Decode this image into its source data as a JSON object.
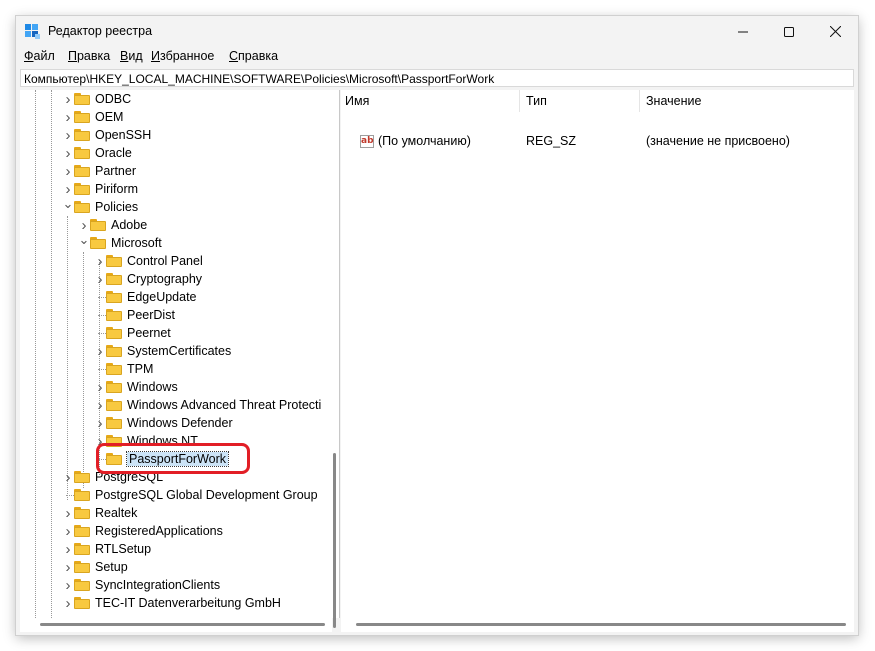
{
  "window": {
    "title": "Редактор реестра",
    "minimize_glyph": "—",
    "maximize_glyph": "☐",
    "close_glyph": "✕"
  },
  "menu": [
    {
      "underline": "Ф",
      "rest": "айл"
    },
    {
      "underline": "П",
      "rest": "равка"
    },
    {
      "underline": "В",
      "rest": "ид"
    },
    {
      "underline": "И",
      "rest": "збранное"
    },
    {
      "underline": "С",
      "rest": "правка"
    }
  ],
  "address_path": "Компьютер\\HKEY_LOCAL_MACHINE\\SOFTWARE\\Policies\\Microsoft\\PassportForWork",
  "tree": {
    "items": [
      {
        "label": "ODBC",
        "level": 0,
        "chevron": "right"
      },
      {
        "label": "OEM",
        "level": 0,
        "chevron": "right"
      },
      {
        "label": "OpenSSH",
        "level": 0,
        "chevron": "right"
      },
      {
        "label": "Oracle",
        "level": 0,
        "chevron": "right"
      },
      {
        "label": "Partner",
        "level": 0,
        "chevron": "right"
      },
      {
        "label": "Piriform",
        "level": 0,
        "chevron": "right"
      },
      {
        "label": "Policies",
        "level": 0,
        "chevron": "down"
      },
      {
        "label": "Adobe",
        "level": 1,
        "chevron": "right"
      },
      {
        "label": "Microsoft",
        "level": 1,
        "chevron": "down"
      },
      {
        "label": "Control Panel",
        "level": 2,
        "chevron": "right"
      },
      {
        "label": "Cryptography",
        "level": 2,
        "chevron": "right"
      },
      {
        "label": "EdgeUpdate",
        "level": 2,
        "chevron": "none"
      },
      {
        "label": "PeerDist",
        "level": 2,
        "chevron": "none"
      },
      {
        "label": "Peernet",
        "level": 2,
        "chevron": "none"
      },
      {
        "label": "SystemCertificates",
        "level": 2,
        "chevron": "right"
      },
      {
        "label": "TPM",
        "level": 2,
        "chevron": "none"
      },
      {
        "label": "Windows",
        "level": 2,
        "chevron": "right"
      },
      {
        "label": "Windows Advanced Threat Protecti",
        "level": 2,
        "chevron": "right"
      },
      {
        "label": "Windows Defender",
        "level": 2,
        "chevron": "right"
      },
      {
        "label": "Windows NT",
        "level": 2,
        "chevron": "right"
      },
      {
        "label": "PassportForWork",
        "level": 2,
        "chevron": "none",
        "selected": true
      },
      {
        "label": "PostgreSQL",
        "level": 0,
        "chevron": "right"
      },
      {
        "label": "PostgreSQL Global Development Group",
        "level": 0,
        "chevron": "none"
      },
      {
        "label": "Realtek",
        "level": 0,
        "chevron": "right"
      },
      {
        "label": "RegisteredApplications",
        "level": 0,
        "chevron": "right"
      },
      {
        "label": "RTLSetup",
        "level": 0,
        "chevron": "right"
      },
      {
        "label": "Setup",
        "level": 0,
        "chevron": "right"
      },
      {
        "label": "SyncIntegrationClients",
        "level": 0,
        "chevron": "right"
      },
      {
        "label": "TEC-IT Datenverarbeitung GmbH",
        "level": 0,
        "chevron": "right"
      }
    ]
  },
  "list": {
    "columns": [
      "Имя",
      "Тип",
      "Значение"
    ],
    "rows": [
      {
        "icon": "ab",
        "name": "(По умолчанию)",
        "type": "REG_SZ",
        "value": "(значение не присвоено)"
      }
    ]
  },
  "colors": {
    "highlight_ring": "#e21e26",
    "selection": "#cce4f7",
    "folder": "#f8c940"
  }
}
